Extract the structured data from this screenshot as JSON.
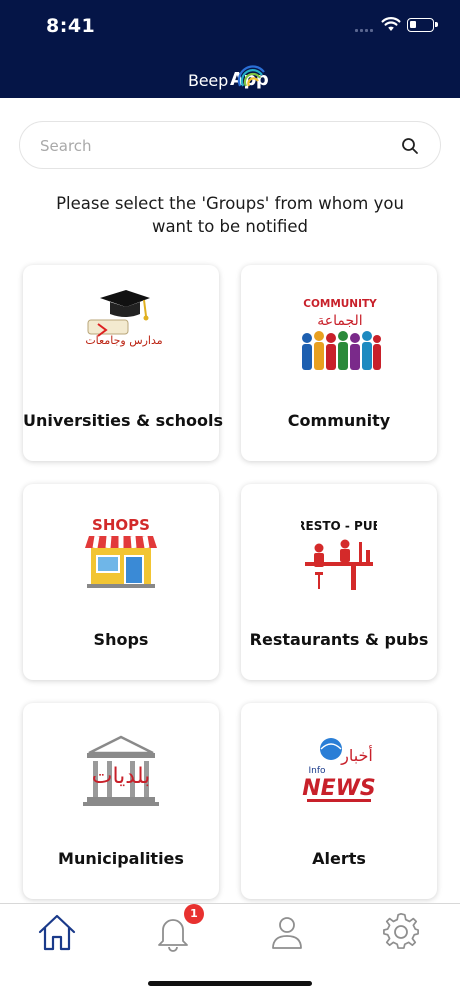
{
  "status_bar": {
    "time": "8:41"
  },
  "brand": {
    "part1": "Beep",
    "part2": "App"
  },
  "search": {
    "placeholder": "Search",
    "value": ""
  },
  "instructions": "Please select the 'Groups' from whom you want to be notified",
  "groups": [
    {
      "label": "Universities & schools",
      "image_text": "مدارس وجامعات"
    },
    {
      "label": "Community",
      "image_text_en": "COMMUNITY",
      "image_text_ar": "الجماعة"
    },
    {
      "label": "Shops",
      "image_text": "SHOPS"
    },
    {
      "label": "Restaurants & pubs",
      "image_text": "RESTO - PUB"
    },
    {
      "label": "Municipalities",
      "image_text": "بلديات"
    },
    {
      "label": "Alerts",
      "image_text_info": "Info",
      "image_text_ar": "أخبار",
      "image_text_news": "NEWS"
    }
  ],
  "tabbar": {
    "items": [
      "home",
      "notifications",
      "profile",
      "settings"
    ],
    "notification_badge": "1"
  },
  "colors": {
    "header_bg": "#051547",
    "accent": "#1a3a8a",
    "badge": "#e8312f",
    "inactive_icon": "#8f8f8f"
  }
}
